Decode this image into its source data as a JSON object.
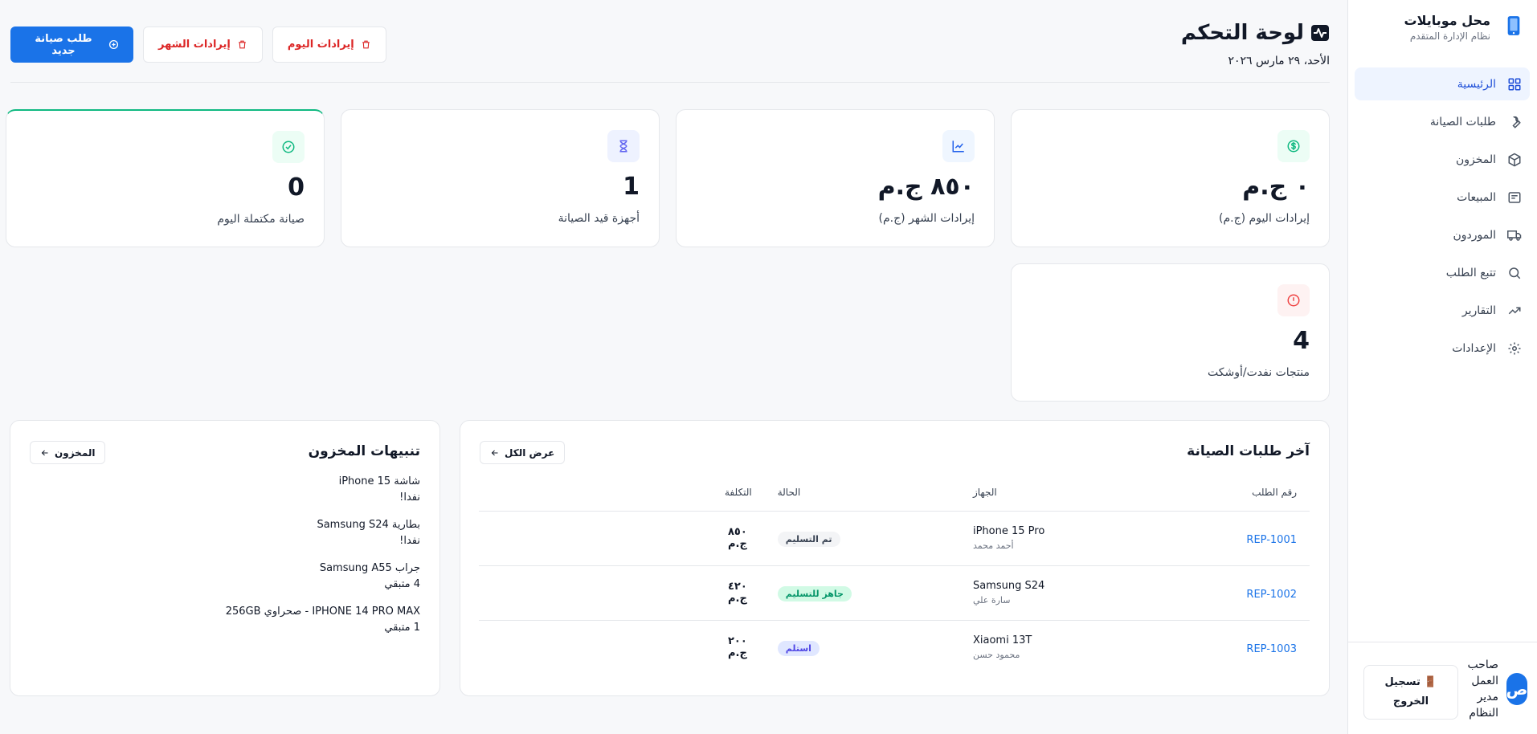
{
  "brand": {
    "title": "محل موبايلات",
    "subtitle": "نظام الإدارة المتقدم"
  },
  "sidebar": {
    "items": [
      {
        "label": "الرئيسية",
        "icon": "grid-icon",
        "active": true
      },
      {
        "label": "طلبات الصيانة",
        "icon": "wrench-icon"
      },
      {
        "label": "المخزون",
        "icon": "box-icon"
      },
      {
        "label": "المبيعات",
        "icon": "receipt-icon"
      },
      {
        "label": "الموردون",
        "icon": "truck-icon"
      },
      {
        "label": "تتبع الطلب",
        "icon": "search-icon"
      },
      {
        "label": "التقارير",
        "icon": "trend-icon"
      },
      {
        "label": "الإعدادات",
        "icon": "gear-icon"
      }
    ],
    "user": {
      "initial": "ص",
      "name": "صاحب العمل",
      "role": "مدير النظام"
    },
    "logout_label": "تسجيل الخروج"
  },
  "header": {
    "title": "لوحة التحكم",
    "date": "الأحد، ٢٩ مارس ٢٠٢٦",
    "actions": {
      "new_repair": "طلب صيانة جديد",
      "month_revenue": "إيرادات الشهر",
      "today_revenue": "إيرادات اليوم"
    }
  },
  "stats": [
    {
      "value": "٠ ج.م",
      "label": "إيرادات اليوم (ج.م)",
      "icon": "dollar-icon",
      "color": "#10b981",
      "bg": "#ecfdf5"
    },
    {
      "value": "٨٥٠ ج.م",
      "label": "إيرادات الشهر (ج.م)",
      "icon": "chart-line-icon",
      "color": "#2563eb",
      "bg": "#eff6ff"
    },
    {
      "value": "1",
      "label": "أجهزة قيد الصيانة",
      "icon": "hourglass-icon",
      "color": "#6366f1",
      "bg": "#eef2ff"
    },
    {
      "value": "0",
      "label": "صيانة مكتملة اليوم",
      "icon": "check-circle-icon",
      "color": "#10b981",
      "bg": "#ecfdf5"
    },
    {
      "value": "4",
      "label": "منتجات نفدت/أوشكت",
      "icon": "alert-circle-icon",
      "color": "#ef4444",
      "bg": "#fef2f2"
    }
  ],
  "repairs": {
    "title": "آخر طلبات الصيانة",
    "view_all": "عرض الكل",
    "columns": [
      "رقم الطلب",
      "الجهاز",
      "الحالة",
      "التكلفة"
    ],
    "rows": [
      {
        "id": "REP-1001",
        "device": "iPhone 15 Pro",
        "customer": "أحمد محمد",
        "status": "تم التسليم",
        "status_fg": "#374151",
        "status_bg": "#f3f4f6",
        "cost": "٨٥٠ ج.م"
      },
      {
        "id": "REP-1002",
        "device": "Samsung S24",
        "customer": "سارة علي",
        "status": "جاهز للتسليم",
        "status_fg": "#059669",
        "status_bg": "#d1fae5",
        "cost": "٤٢٠ ج.م"
      },
      {
        "id": "REP-1003",
        "device": "Xiaomi 13T",
        "customer": "محمود حسن",
        "status": "استلم",
        "status_fg": "#4f46e5",
        "status_bg": "#e0e7ff",
        "cost": "٢٠٠ ج.م"
      }
    ]
  },
  "inventory_alerts": {
    "title": "تنبيهات المخزون",
    "link": "المخزون",
    "items": [
      {
        "name": "شاشة iPhone 15",
        "status": "نفدا!"
      },
      {
        "name": "بطارية Samsung S24",
        "status": "نفدا!"
      },
      {
        "name": "جراب Samsung A55",
        "status": "4 متبقي"
      },
      {
        "name": "IPHONE 14 PRO MAX - صحراوي 256GB",
        "status": "1 متبقي"
      }
    ]
  },
  "colors": {
    "accent": "#1a73e8",
    "danger": "#dc2626",
    "success": "#10b981"
  }
}
